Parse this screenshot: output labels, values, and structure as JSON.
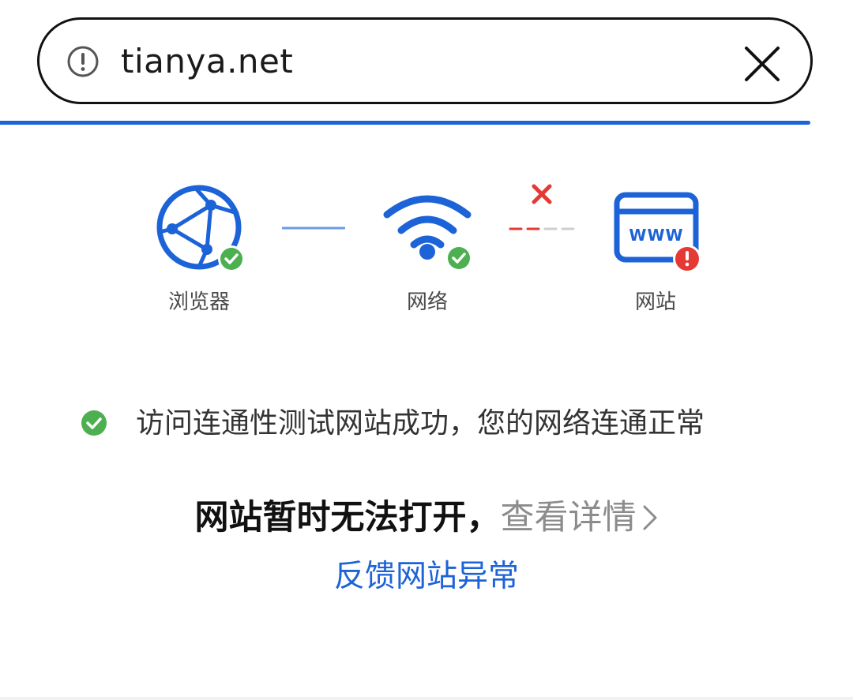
{
  "address_bar": {
    "info_icon": "info-circle-icon",
    "url": "tianya.net",
    "close_icon": "close-icon"
  },
  "diagnostics": {
    "browser": {
      "label": "浏览器",
      "icon": "browser-globe-icon",
      "status": "ok"
    },
    "network": {
      "label": "网络",
      "icon": "wifi-icon",
      "status": "ok"
    },
    "website": {
      "label": "网站",
      "icon": "www-window-icon",
      "status": "error"
    },
    "colors": {
      "accent": "#1d63d8",
      "ok": "#4caf50",
      "error": "#e53935"
    }
  },
  "status_message": "访问连通性测试网站成功，您的网络连通正常",
  "headline": {
    "main": "网站暂时无法打开，",
    "details": "查看详情"
  },
  "feedback_link": "反馈网站异常"
}
